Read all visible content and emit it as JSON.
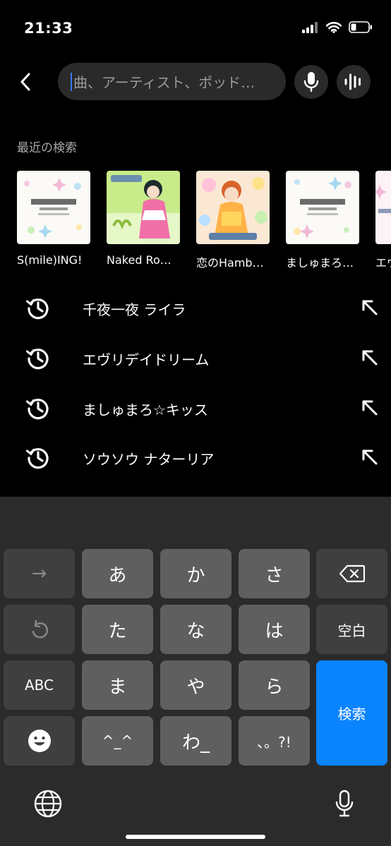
{
  "status_bar": {
    "time": "21:33"
  },
  "search": {
    "placeholder": "曲、アーティスト、ポッド…"
  },
  "recent": {
    "title": "最近の検索",
    "items": [
      {
        "label": "S(mile)ING!"
      },
      {
        "label": "Naked Ro…"
      },
      {
        "label": "恋のHamb…"
      },
      {
        "label": "ましゅまろ…"
      },
      {
        "label": "エヴ"
      }
    ]
  },
  "history": [
    {
      "label": "千夜一夜 ライラ"
    },
    {
      "label": "エヴリデイドリーム"
    },
    {
      "label": "ましゅまろ☆キッス"
    },
    {
      "label": "ソウソウ ナターリア"
    }
  ],
  "keyboard": {
    "row1": [
      "→",
      "あ",
      "か",
      "さ"
    ],
    "row2": [
      "た",
      "な",
      "は",
      "空白"
    ],
    "row3": [
      "ABC",
      "ま",
      "や",
      "ら"
    ],
    "row4": [
      "^_^",
      "わ_",
      "、。?!"
    ],
    "search_key": "検索"
  },
  "colors": {
    "accent": "#0a84ff",
    "background": "#000000",
    "keyboard": "#2b2b2b"
  }
}
